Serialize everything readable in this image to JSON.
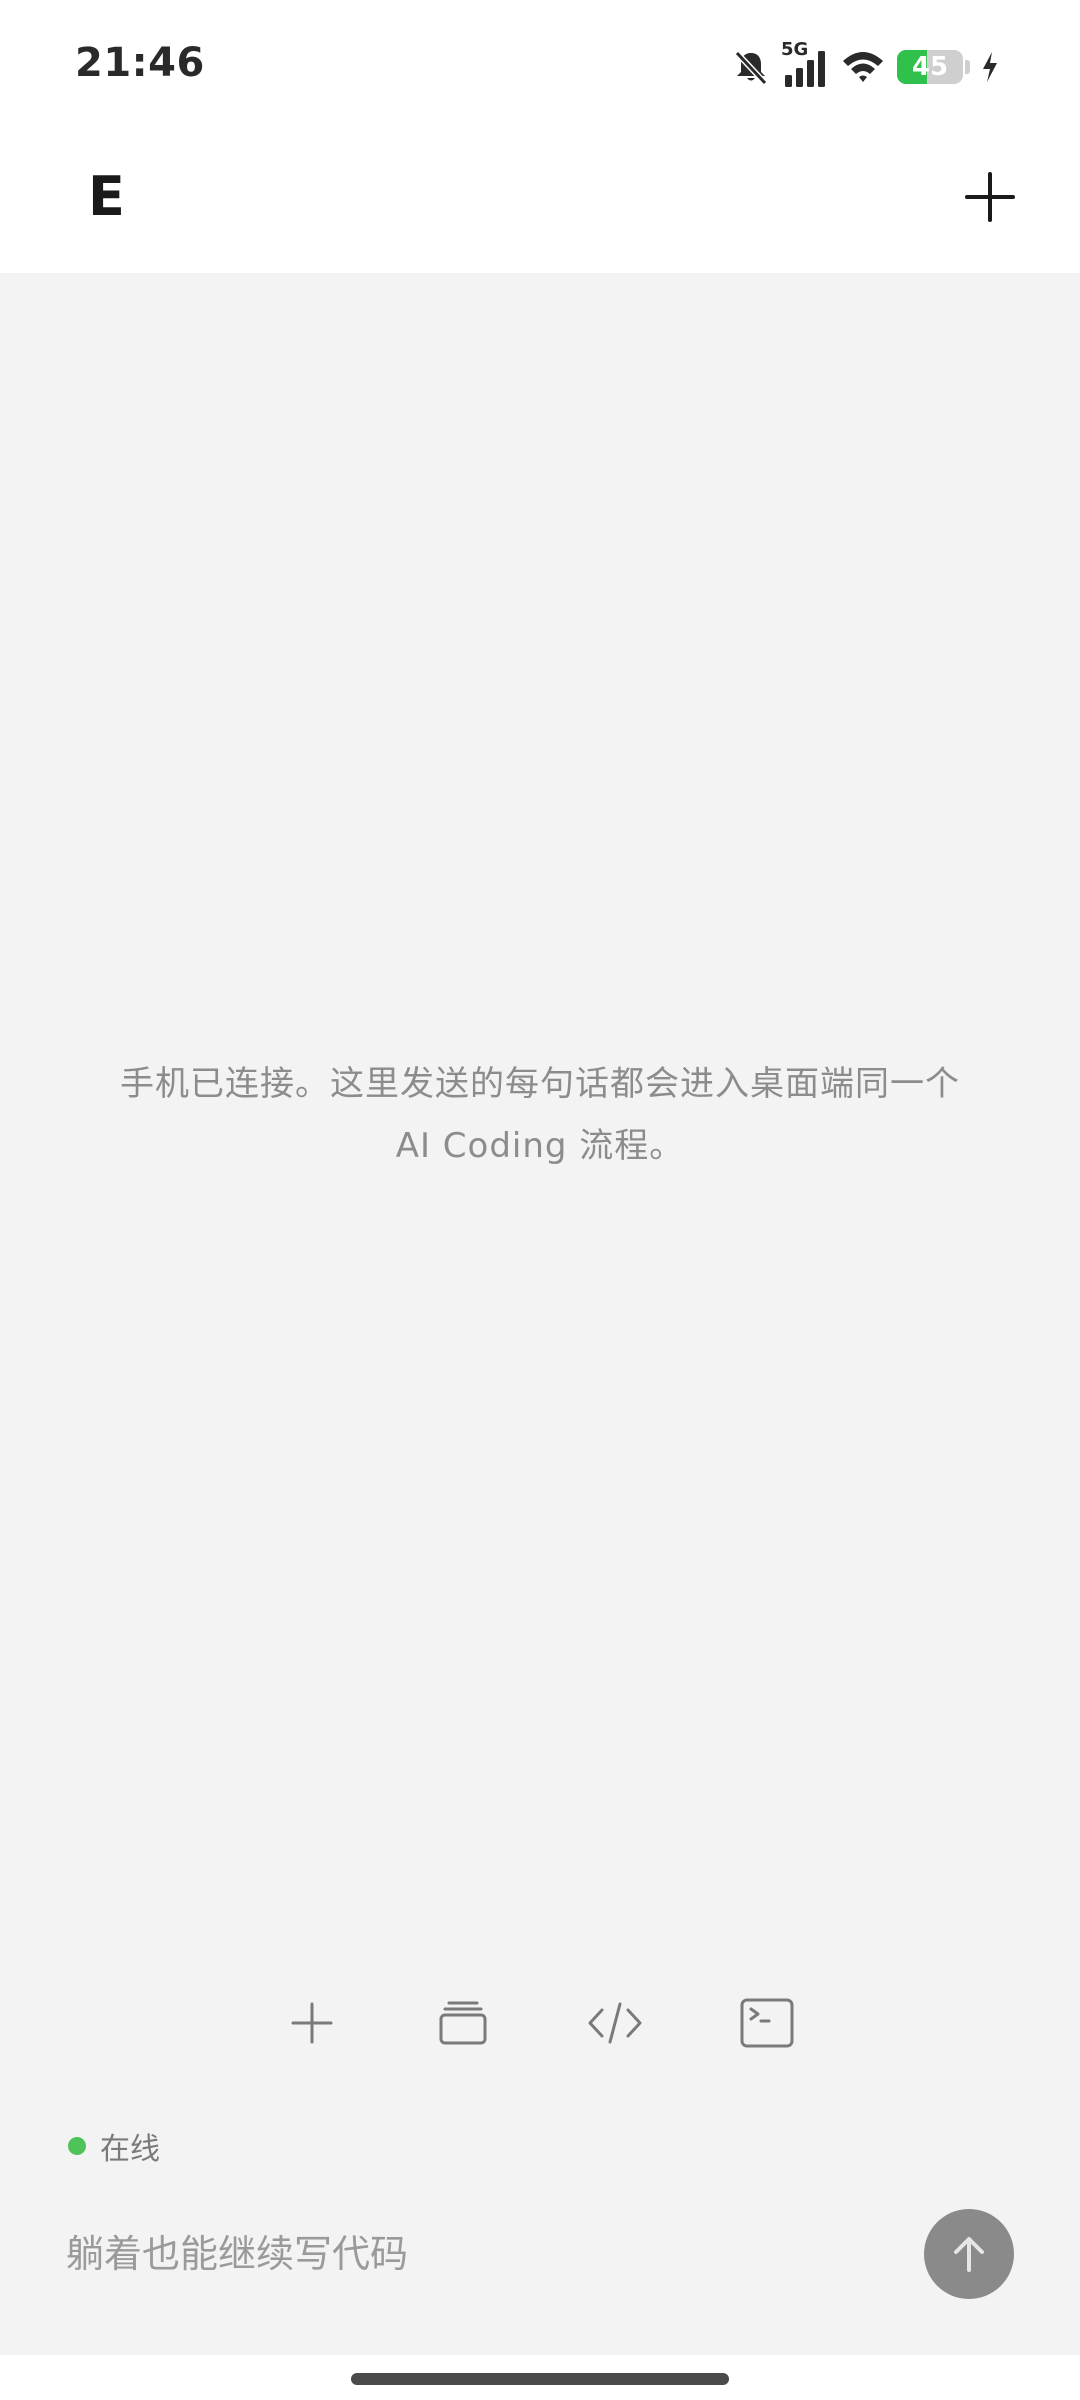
{
  "status_bar": {
    "time": "21:46",
    "network": "5G",
    "battery_level": "45",
    "battery_fraction": 0.45,
    "icons": [
      "bell-muted-icon",
      "signal-icon",
      "wifi-icon",
      "battery-icon",
      "charging-icon"
    ]
  },
  "header": {
    "title": "E",
    "add_icon": "plus-icon"
  },
  "main": {
    "empty_message": "手机已连接。这里发送的每句话都会进入桌面端同一个 AI Coding 流程。"
  },
  "toolbar": {
    "items": [
      {
        "icon": "plus-icon"
      },
      {
        "icon": "stack-icon"
      },
      {
        "icon": "code-icon"
      },
      {
        "icon": "terminal-icon"
      }
    ]
  },
  "connection": {
    "status_label": "在线",
    "status_color": "#4fc35a"
  },
  "composer": {
    "placeholder": "躺着也能继续写代码",
    "value": "",
    "send_icon": "arrow-up-icon",
    "send_color": "#8a8a8a"
  },
  "colors": {
    "background": "#f3f3f3",
    "battery_green": "#2fc14b"
  }
}
